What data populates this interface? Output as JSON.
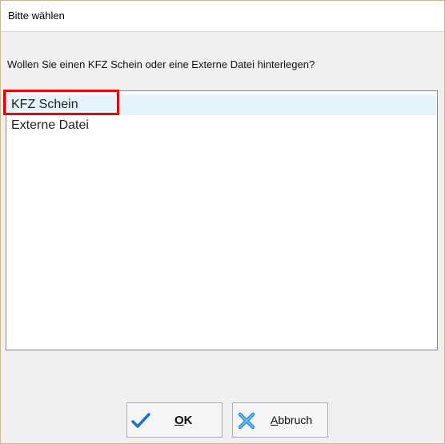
{
  "window": {
    "title": "Bitte wählen"
  },
  "prompt": "Wollen Sie einen KFZ Schein oder eine Externe Datei hinterlegen?",
  "list": {
    "items": [
      {
        "label": "KFZ Schein",
        "selected": true
      },
      {
        "label": "Externe Datei",
        "selected": false
      }
    ]
  },
  "buttons": {
    "ok": {
      "accel": "O",
      "rest": "K",
      "icon": "checkmark-icon"
    },
    "cancel": {
      "accel": "A",
      "rest": "bbruch",
      "icon": "cross-icon"
    }
  },
  "colors": {
    "selection_bg": "#e5f3fb",
    "highlight_frame": "#e8000b",
    "ok_icon": "#1e73c8",
    "cancel_icon": "#2e8fd6"
  }
}
